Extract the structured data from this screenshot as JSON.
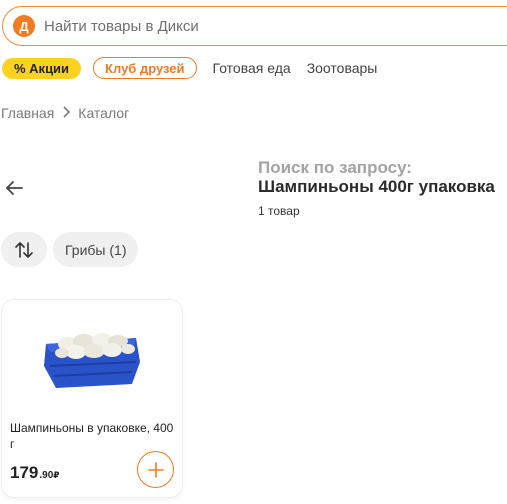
{
  "header": {
    "logo_letter": "Д",
    "search_placeholder": "Найти товары в Дикси"
  },
  "nav": {
    "promo_label": "% Акции",
    "club_label": "Клуб друзей",
    "links": [
      "Готовая еда",
      "Зоотовары"
    ]
  },
  "breadcrumb": {
    "items": [
      "Главная",
      "Каталог"
    ]
  },
  "search_result": {
    "query_label": "Поиск по запросу:",
    "query_value": "Шампиньоны 400г упаковка",
    "count_text": "1 товар"
  },
  "filters": {
    "chip_label": "Грибы (1)"
  },
  "product": {
    "title": "Шампиньоны в упаковке, 400 г",
    "price_int": "179",
    "price_frac": ".90",
    "currency": "₽"
  },
  "colors": {
    "brand_orange": "#f07b22",
    "promo_yellow": "#ffd21f",
    "chip_gray": "#f0f0f0"
  },
  "icons": {
    "back": "arrow-left-icon",
    "sort": "sort-arrows-icon",
    "breadcrumb_sep": "chevron-right-icon",
    "add": "plus-icon"
  }
}
